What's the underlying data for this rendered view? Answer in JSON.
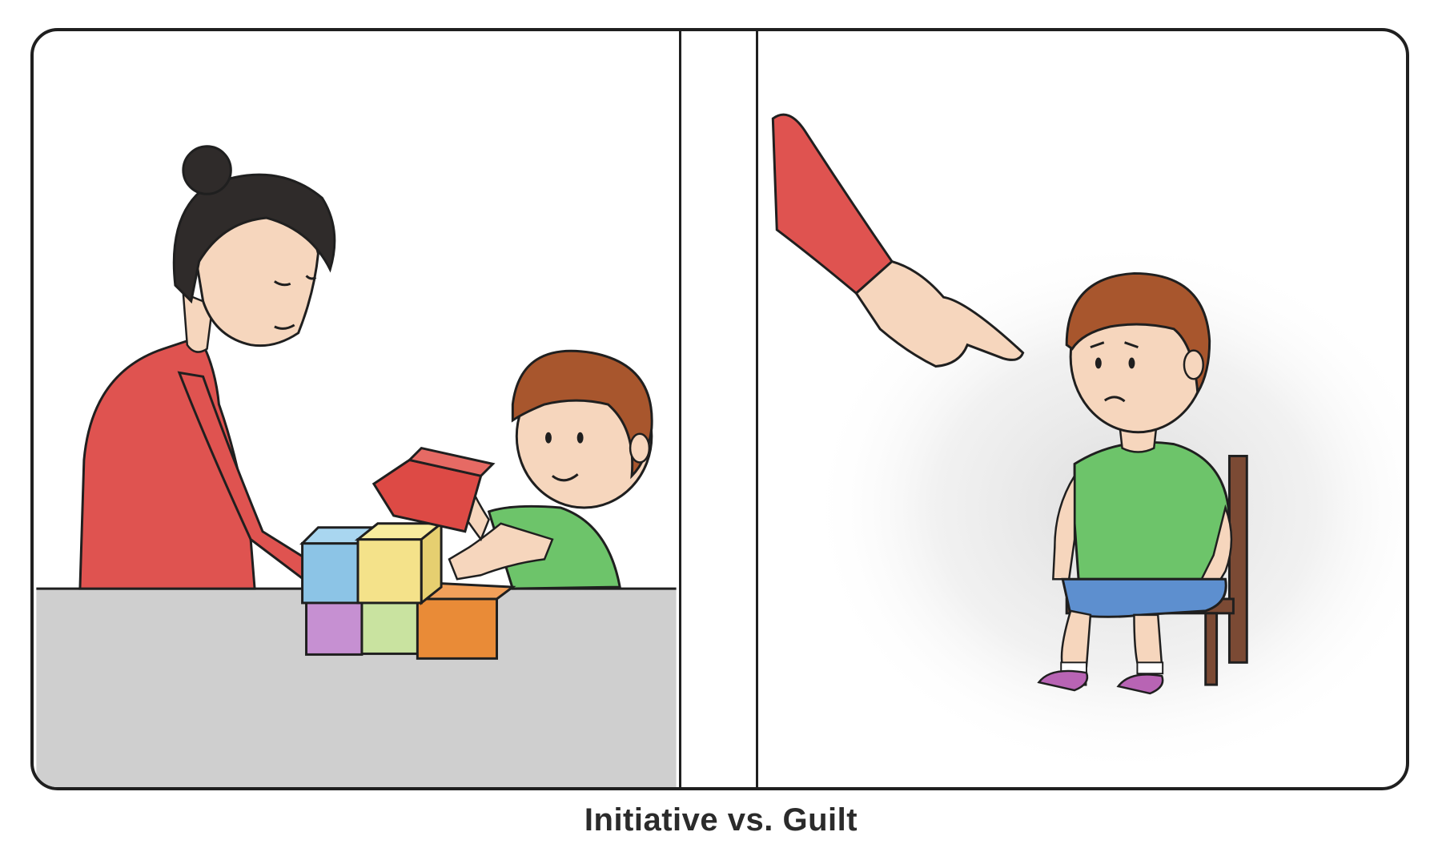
{
  "caption": "Initiative vs. Guilt",
  "panels": [
    {
      "scene": "left",
      "figures": [
        "mother",
        "child",
        "toy-blocks",
        "table"
      ]
    },
    {
      "scene": "right",
      "figures": [
        "pointing-hand",
        "sad-child",
        "chair"
      ]
    }
  ],
  "colors": {
    "outline": "#1f1f1f",
    "shirt_red": "#df5350",
    "shirt_green": "#6dc46a",
    "shorts_blue": "#5d8fcf",
    "hair_brown": "#a8562d",
    "hair_dark": "#2f2b2a",
    "skin": "#f6d6bd",
    "table_gray": "#cfcfcf",
    "chair_brown": "#7b4a34",
    "block_blue": "#8cc4e6",
    "block_yellow": "#f4e28a",
    "block_red": "#dd4a45",
    "block_purple": "#c690d2",
    "block_lightgreen": "#c9e3a0",
    "block_orange": "#e98b37",
    "shoe_purple": "#b864b4"
  }
}
